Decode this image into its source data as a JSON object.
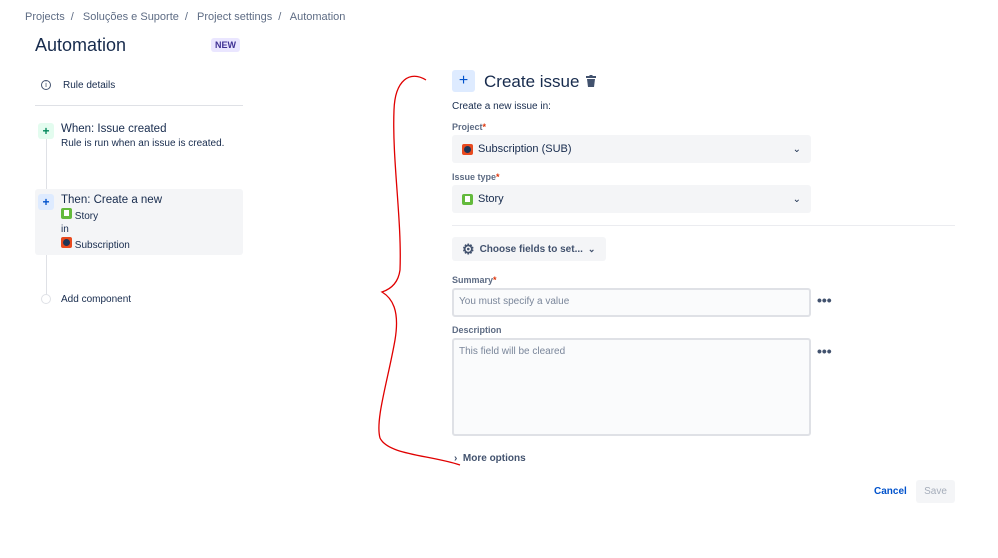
{
  "breadcrumb": [
    "Projects",
    "Soluções e Suporte",
    "Project settings",
    "Automation"
  ],
  "page_title": "Automation",
  "badge": "NEW",
  "sidebar": {
    "rule_details": "Rule details",
    "trigger": {
      "title": "When: Issue created",
      "desc": "Rule is run when an issue is created."
    },
    "action": {
      "title": "Then: Create a new",
      "type": "Story",
      "in": "in",
      "project": "Subscription"
    },
    "add_component": "Add component"
  },
  "panel": {
    "title": "Create issue",
    "subtitle": "Create a new issue in:",
    "project_label": "Project",
    "project_value": "Subscription (SUB)",
    "issue_type_label": "Issue type",
    "issue_type_value": "Story",
    "choose_fields": "Choose fields to set...",
    "summary_label": "Summary",
    "summary_placeholder": "You must specify a value",
    "description_label": "Description",
    "description_placeholder": "This field will be cleared",
    "more_options": "More options",
    "required": "*",
    "more_icon": "•••"
  },
  "footer": {
    "cancel": "Cancel",
    "save": "Save"
  },
  "colors": {
    "annotation": "#e00000",
    "link": "#0052cc"
  }
}
